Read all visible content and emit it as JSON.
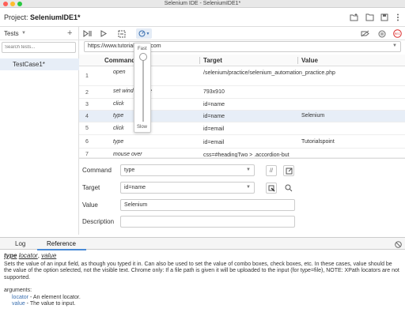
{
  "window": {
    "title": "Selenium IDE - SeleniumIDE1*"
  },
  "project": {
    "label": "Project:",
    "name": "SeleniumIDE1*"
  },
  "sidebar": {
    "header_label": "Tests",
    "search_placeholder": "Search tests...",
    "tests": [
      {
        "name": "TestCase1*"
      }
    ]
  },
  "url": {
    "value": "https://www.tutorialspoint.com"
  },
  "table": {
    "headers": {
      "command": "Command",
      "target": "Target",
      "value": "Value"
    },
    "rows": [
      {
        "num": "1",
        "command": "open",
        "target": "/selenium/practice/selenium_automation_practice.php",
        "value": ""
      },
      {
        "num": "2",
        "command": "set window size",
        "target": "793x910",
        "value": ""
      },
      {
        "num": "3",
        "command": "click",
        "target": "id=name",
        "value": ""
      },
      {
        "num": "4",
        "command": "type",
        "target": "id=name",
        "value": "Selenium"
      },
      {
        "num": "5",
        "command": "click",
        "target": "id=email",
        "value": ""
      },
      {
        "num": "6",
        "command": "type",
        "target": "id=email",
        "value": "Tutorialspoint"
      },
      {
        "num": "7",
        "command": "mouse over",
        "target": "css=#headingTwo > .accordion-but",
        "value": ""
      }
    ],
    "selected_row": 4
  },
  "speed": {
    "fast_label": "Fast",
    "slow_label": "Slow",
    "level": 0.0
  },
  "editor": {
    "command_label": "Command",
    "command_value": "type",
    "comment_btn": "//",
    "target_label": "Target",
    "target_value": "id=name",
    "value_label": "Value",
    "value_value": "Selenium",
    "description_label": "Description",
    "description_value": ""
  },
  "bottom": {
    "tabs": [
      {
        "label": "Log"
      },
      {
        "label": "Reference"
      }
    ],
    "active_tab": "Reference",
    "reference": {
      "sig_cmd": "type",
      "sig_arg1": "locator",
      "sig_arg2": "value",
      "description": "Sets the value of an input field, as though you typed it in. Can also be used to set the value of combo boxes, check boxes, etc. In these cases, value should be the value of the option selected, not the visible text. Chrome only: If a file path is given it will be uploaded to the input (for type=file), NOTE: XPath locators are not supported.",
      "args_heading": "arguments:",
      "args": [
        {
          "name": "locator",
          "desc": " - An element locator."
        },
        {
          "name": "value",
          "desc": " - The value to input."
        }
      ]
    }
  },
  "colors": {
    "accent": "#4a8ad6",
    "selected_row": "#e7eef7",
    "record": "#d33",
    "close": "#ff5f57",
    "minimize": "#febc2e",
    "zoom": "#28c840"
  }
}
